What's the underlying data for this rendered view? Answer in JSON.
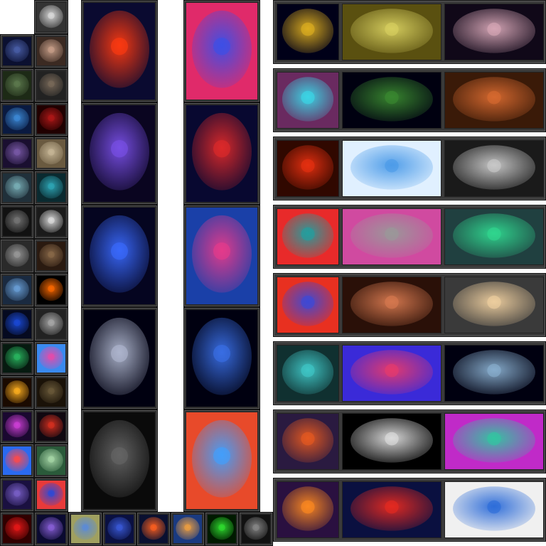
{
  "gallery": {
    "small_thumbs": [
      {
        "id": "thumb-dark-creature",
        "icon": "creature-icon",
        "colors": [
          "#ddd",
          "#333"
        ]
      },
      {
        "id": "thumb-blue-woman",
        "icon": "portrait-icon",
        "colors": [
          "#4a5fa8",
          "#0b1030"
        ]
      },
      {
        "id": "thumb-face-hands",
        "icon": "portrait-icon",
        "colors": [
          "#c9a08a",
          "#3b2a22"
        ]
      },
      {
        "id": "thumb-green-woman",
        "icon": "portrait-icon",
        "colors": [
          "#5d7a4e",
          "#1d2a16"
        ]
      },
      {
        "id": "thumb-red-eye-cat",
        "icon": "cat-icon",
        "colors": [
          "#7a6a5a",
          "#222"
        ]
      },
      {
        "id": "thumb-blue-alien",
        "icon": "alien-icon",
        "colors": [
          "#3d8bd8",
          "#0a1a40"
        ]
      },
      {
        "id": "thumb-red-skull",
        "icon": "skull-icon",
        "colors": [
          "#b01818",
          "#200000"
        ]
      },
      {
        "id": "thumb-purple-woman",
        "icon": "portrait-icon",
        "colors": [
          "#7a5aa8",
          "#1a0f30"
        ]
      },
      {
        "id": "thumb-crab-creature",
        "icon": "creature-icon",
        "colors": [
          "#c8b898",
          "#6a5a40"
        ]
      },
      {
        "id": "thumb-alien-ears",
        "icon": "alien-icon",
        "colors": [
          "#7ab0b8",
          "#20303a"
        ]
      },
      {
        "id": "thumb-cyan-face",
        "icon": "portrait-icon",
        "colors": [
          "#2fa8b8",
          "#0a2a30"
        ]
      },
      {
        "id": "thumb-two-faces",
        "icon": "portrait-icon",
        "colors": [
          "#777",
          "#111"
        ]
      },
      {
        "id": "thumb-clown",
        "icon": "mask-icon",
        "colors": [
          "#e0e0e0",
          "#1a1a1a"
        ]
      },
      {
        "id": "thumb-gray-alien",
        "icon": "alien-icon",
        "colors": [
          "#999",
          "#2a2a2a"
        ]
      },
      {
        "id": "thumb-brown-creature",
        "icon": "creature-icon",
        "colors": [
          "#8a6a4a",
          "#2a1a10"
        ]
      },
      {
        "id": "thumb-robot-woman",
        "icon": "robot-icon",
        "colors": [
          "#6aa0d8",
          "#1a2a40"
        ]
      },
      {
        "id": "thumb-eclipse",
        "icon": "eclipse-icon",
        "colors": [
          "#ff6a00",
          "#000"
        ]
      },
      {
        "id": "thumb-blue-eye",
        "icon": "eye-icon",
        "colors": [
          "#1a4ad8",
          "#050a20"
        ]
      },
      {
        "id": "thumb-silver-robot",
        "icon": "robot-icon",
        "colors": [
          "#aaa",
          "#222"
        ]
      },
      {
        "id": "thumb-green-globe",
        "icon": "globe-icon",
        "colors": [
          "#2ab860",
          "#061a10"
        ]
      },
      {
        "id": "thumb-rainbow-swirl",
        "icon": "swirl-icon",
        "colors": [
          "#e84aa8",
          "#3a8af0"
        ]
      },
      {
        "id": "thumb-flare",
        "icon": "flare-icon",
        "colors": [
          "#ffb020",
          "#1a0a00"
        ]
      },
      {
        "id": "thumb-monkey",
        "icon": "creature-icon",
        "colors": [
          "#6a5a3a",
          "#1a1208"
        ]
      },
      {
        "id": "thumb-pink-laser",
        "icon": "laser-icon",
        "colors": [
          "#d040d8",
          "#1a0830"
        ]
      },
      {
        "id": "thumb-volcano",
        "icon": "volcano-icon",
        "colors": [
          "#d83020",
          "#100810"
        ]
      },
      {
        "id": "thumb-mandala",
        "icon": "mandala-icon",
        "colors": [
          "#ff4a4a",
          "#2a6af0"
        ]
      },
      {
        "id": "thumb-ostrich",
        "icon": "bird-icon",
        "colors": [
          "#a8d8a8",
          "#2a5a3a"
        ]
      },
      {
        "id": "thumb-purple-alien",
        "icon": "alien-icon",
        "colors": [
          "#7a60c8",
          "#1a1040"
        ]
      },
      {
        "id": "thumb-ring-portal",
        "icon": "portal-icon",
        "colors": [
          "#2a4ad8",
          "#e83a3a"
        ]
      },
      {
        "id": "thumb-red-burst",
        "icon": "burst-icon",
        "colors": [
          "#e81818",
          "#300000"
        ]
      },
      {
        "id": "thumb-laser-face",
        "icon": "laser-icon",
        "colors": [
          "#8a60d8",
          "#0a0a30"
        ]
      },
      {
        "id": "thumb-blue-fractal",
        "icon": "fractal-icon",
        "colors": [
          "#5a8ad8",
          "#a0a060"
        ]
      },
      {
        "id": "thumb-blue-rose",
        "icon": "rose-icon",
        "colors": [
          "#3a5ad8",
          "#0a1040"
        ]
      },
      {
        "id": "thumb-comet",
        "icon": "comet-icon",
        "colors": [
          "#ff6020",
          "#0a1030"
        ]
      },
      {
        "id": "thumb-butterfly",
        "icon": "butterfly-icon",
        "colors": [
          "#f0a040",
          "#1a3a80"
        ]
      },
      {
        "id": "thumb-green-grid",
        "icon": "grid-icon",
        "colors": [
          "#30e030",
          "#001a00"
        ]
      },
      {
        "id": "thumb-asteroid",
        "icon": "asteroid-icon",
        "colors": [
          "#888",
          "#111"
        ]
      }
    ],
    "tall_panels": [
      {
        "id": "panel-planet-explosion",
        "icon": "planet-icon",
        "colors": [
          "#ff3a10",
          "#0a0a30"
        ]
      },
      {
        "id": "panel-nebula-city",
        "icon": "nebula-icon",
        "colors": [
          "#3a50e8",
          "#e02a6a"
        ]
      },
      {
        "id": "panel-purple-planets",
        "icon": "planet-icon",
        "colors": [
          "#7a50e8",
          "#0a0520"
        ]
      },
      {
        "id": "panel-city-night",
        "icon": "city-icon",
        "colors": [
          "#e02a2a",
          "#080830"
        ]
      },
      {
        "id": "panel-blue-energy",
        "icon": "energy-icon",
        "colors": [
          "#3a6aff",
          "#050520"
        ]
      },
      {
        "id": "panel-neon-city",
        "icon": "city-icon",
        "colors": [
          "#e83a8a",
          "#1a40a8"
        ]
      },
      {
        "id": "panel-robots",
        "icon": "robot-icon",
        "colors": [
          "#b0b8d0",
          "#000010"
        ]
      },
      {
        "id": "panel-blue-skyline",
        "icon": "city-icon",
        "colors": [
          "#3a70e8",
          "#000010"
        ]
      },
      {
        "id": "panel-dark-dogs",
        "icon": "dog-icon",
        "colors": [
          "#666",
          "#0a0a0a"
        ]
      },
      {
        "id": "panel-cyber-runner",
        "icon": "runner-icon",
        "colors": [
          "#40a0ff",
          "#e84a2a"
        ]
      }
    ],
    "wide_rows": [
      [
        {
          "id": "wide-spaceship",
          "icon": "spaceship-icon",
          "colors": [
            "#e0b020",
            "#000018"
          ]
        },
        {
          "id": "wide-yellow-alien-plant",
          "icon": "plant-icon",
          "colors": [
            "#d8d060",
            "#5a5010"
          ]
        },
        {
          "id": "wide-cyber-woman",
          "icon": "portrait-icon",
          "colors": [
            "#d8a8b8",
            "#100818"
          ]
        }
      ],
      [
        {
          "id": "wide-mech-walker",
          "icon": "robot-icon",
          "colors": [
            "#3ad8e8",
            "#6a2a60"
          ]
        },
        {
          "id": "wide-earth-horizon",
          "icon": "planet-icon",
          "colors": [
            "#3a8a30",
            "#000010"
          ]
        },
        {
          "id": "wide-steampunk-woman",
          "icon": "portrait-icon",
          "colors": [
            "#d86a30",
            "#3a1a08"
          ]
        }
      ],
      [
        {
          "id": "wide-red-nebula",
          "icon": "nebula-icon",
          "colors": [
            "#e83010",
            "#300800"
          ]
        },
        {
          "id": "wide-starfighter",
          "icon": "spaceship-icon",
          "colors": [
            "#4a9ae8",
            "#e0f0ff"
          ]
        },
        {
          "id": "wide-barbed-face",
          "icon": "portrait-icon",
          "colors": [
            "#ccc",
            "#1a1a1a"
          ]
        }
      ],
      [
        {
          "id": "wide-helix-nebula",
          "icon": "nebula-icon",
          "colors": [
            "#20a0a0",
            "#e82a2a"
          ]
        },
        {
          "id": "wide-moon-city",
          "icon": "moon-icon",
          "colors": [
            "#999",
            "#d04aa0"
          ]
        },
        {
          "id": "wide-green-bridge",
          "icon": "bridge-icon",
          "colors": [
            "#30d890",
            "#204040"
          ]
        }
      ],
      [
        {
          "id": "wide-space-city",
          "icon": "city-icon",
          "colors": [
            "#3a4ad8",
            "#e83020"
          ]
        },
        {
          "id": "wide-alien-ruins",
          "icon": "alien-icon",
          "colors": [
            "#d87a50",
            "#2a1008"
          ]
        },
        {
          "id": "wide-repeated-heads",
          "icon": "portrait-icon",
          "colors": [
            "#f0d0a0",
            "#3a3a3a"
          ]
        }
      ],
      [
        {
          "id": "wide-green-monsters",
          "icon": "creature-icon",
          "colors": [
            "#40c8c8",
            "#103030"
          ]
        },
        {
          "id": "wide-retro-grid",
          "icon": "grid-icon",
          "colors": [
            "#e83a6a",
            "#3a2ad8"
          ]
        },
        {
          "id": "wide-cyborg-woman",
          "icon": "robot-icon",
          "colors": [
            "#8ab0d0",
            "#000010"
          ]
        }
      ],
      [
        {
          "id": "wide-ufo-city",
          "icon": "ufo-icon",
          "colors": [
            "#e85a20",
            "#2a1a40"
          ]
        },
        {
          "id": "wide-bw-machine",
          "icon": "machine-icon",
          "colors": [
            "#e0e0e0",
            "#000"
          ]
        },
        {
          "id": "wide-aurora-tree",
          "icon": "tree-icon",
          "colors": [
            "#30c8a0",
            "#c02ac8"
          ]
        }
      ],
      [
        {
          "id": "wide-fire-tunnel",
          "icon": "tunnel-icon",
          "colors": [
            "#ff8a20",
            "#2a1040"
          ]
        },
        {
          "id": "wide-red-ship-galaxy",
          "icon": "spaceship-icon",
          "colors": [
            "#e82a20",
            "#0a1040"
          ]
        },
        {
          "id": "wide-painted-eye",
          "icon": "eye-icon",
          "colors": [
            "#2a6ad8",
            "#f0f0f0"
          ]
        }
      ]
    ]
  }
}
